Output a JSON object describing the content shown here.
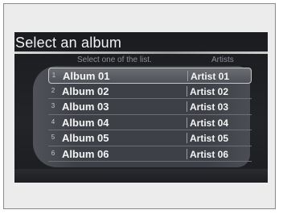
{
  "screen": {
    "title": "Select an album",
    "hint": "Select one of the list.",
    "artists_header": "Artists"
  },
  "rows": [
    {
      "number": "1",
      "album": "Album 01",
      "artist": "Artist 01"
    },
    {
      "number": "2",
      "album": "Album 02",
      "artist": "Artist 02"
    },
    {
      "number": "3",
      "album": "Album 03",
      "artist": "Artist 03"
    },
    {
      "number": "4",
      "album": "Album 04",
      "artist": "Artist 04"
    },
    {
      "number": "5",
      "album": "Album 05",
      "artist": "Artist 05"
    },
    {
      "number": "6",
      "album": "Album 06",
      "artist": "Artist 06"
    }
  ],
  "selected_index": 0
}
